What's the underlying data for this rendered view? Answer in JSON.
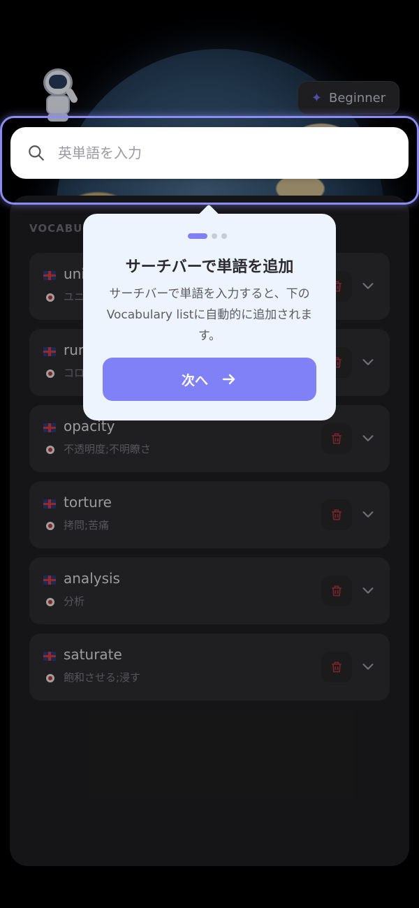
{
  "header": {
    "level_label": "Beginner"
  },
  "search": {
    "placeholder": "英単語を入力"
  },
  "vocabulary": {
    "section_title": "VOCABU",
    "items": [
      {
        "word": "uni",
        "meaning": "ユニ"
      },
      {
        "word": "run",
        "meaning": "コロ"
      },
      {
        "word": "opacity",
        "meaning": "不透明度;不明瞭さ"
      },
      {
        "word": "torture",
        "meaning": "拷問;苦痛"
      },
      {
        "word": "analysis",
        "meaning": "分析"
      },
      {
        "word": "saturate",
        "meaning": "飽和させる;浸す"
      }
    ]
  },
  "tooltip": {
    "title": "サーチバーで単語を追加",
    "description": "サーチバーで単語を入力すると、下のVocabulary listに自動的に追加されます。",
    "next_label": "次へ",
    "step": 1,
    "total_steps": 3
  },
  "colors": {
    "accent": "#8081f6",
    "highlight_ring": "#8b8cf4",
    "delete_icon": "#a8323e"
  },
  "icons": {
    "search": "search-icon",
    "level": "sparkle-icon",
    "delete": "trash-icon",
    "expand": "chevron-down-icon",
    "next": "arrow-right-icon"
  }
}
